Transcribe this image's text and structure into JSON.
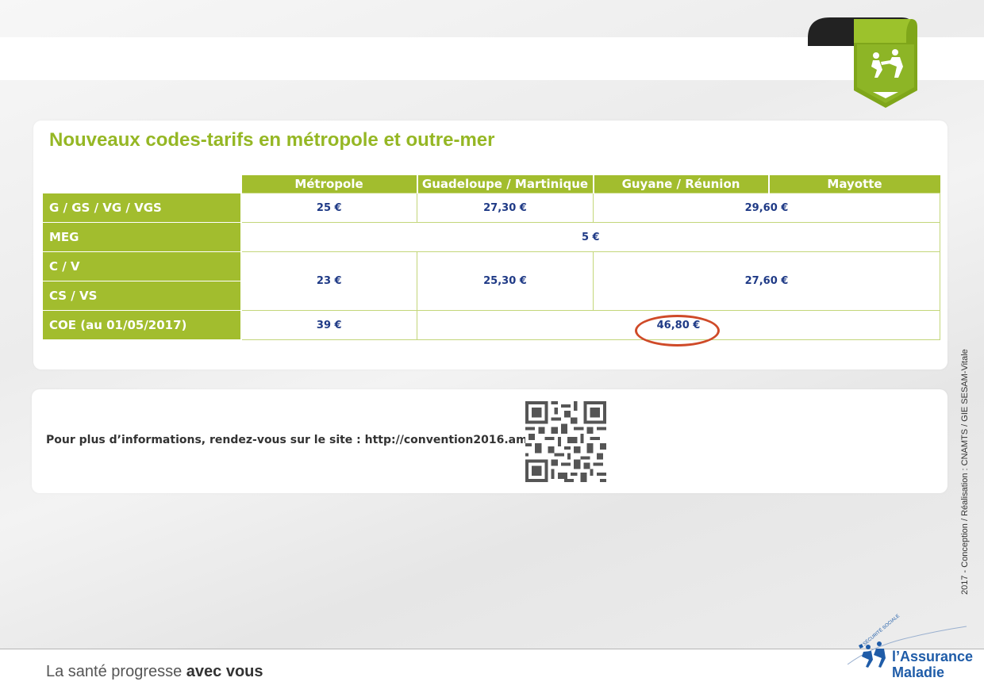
{
  "title": "Nouveaux codes-tarifs en métropole et outre-mer",
  "table": {
    "headers": [
      "Métropole",
      "Guadeloupe / Martinique",
      "Guyane / Réunion",
      "Mayotte"
    ],
    "rows": {
      "g": {
        "label": "G / GS / VG / VGS",
        "metropole": "25 €",
        "guadeloupe_martinique": "27,30 €",
        "guyane_reunion_mayotte": "29,60 €"
      },
      "meg": {
        "label": "MEG",
        "all": "5 €"
      },
      "cv": {
        "label": "C / V"
      },
      "csvs": {
        "label": "CS / VS"
      },
      "cv_csvs_values": {
        "metropole": "23 €",
        "guadeloupe_martinique": "25,30 €",
        "guyane_reunion_mayotte": "27,60 €"
      },
      "coe": {
        "label": "COE (au 01/05/2017)",
        "metropole": "39 €",
        "outre_mer": "46,80 €"
      }
    }
  },
  "info": {
    "text": "Pour plus d’informations, rendez-vous sur le site : http://convention2016.ameli.fr/"
  },
  "credits": "2017 - Conception / Réalisation : CNAMTS / GIE SESAM-Vitale",
  "footer": {
    "slogan_regular": "La santé progresse ",
    "slogan_bold": "avec vous",
    "logo_line1": "l’Assurance",
    "logo_line2": "Maladie",
    "logo_small": "SÉCURITÉ SOCIALE"
  },
  "colors": {
    "accent_green": "#a2bd2e",
    "title_green": "#95b724",
    "value_blue": "#1f3a86",
    "highlight_red": "#cf4a28"
  }
}
